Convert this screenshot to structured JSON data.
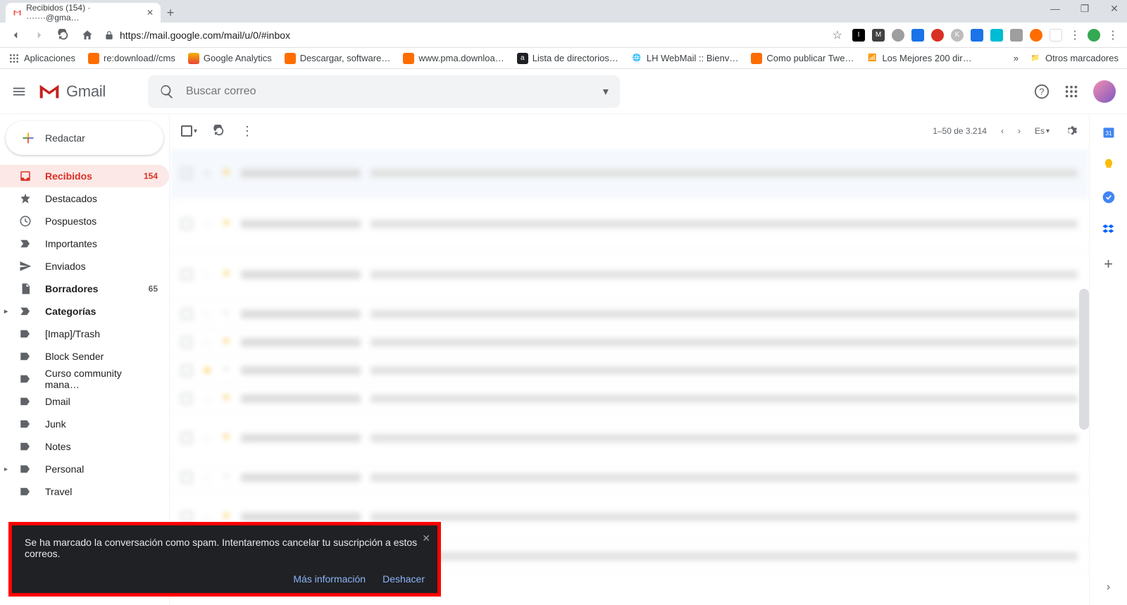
{
  "browser": {
    "tab_title": "Recibidos (154) · ·······@gma…",
    "url": "https://mail.google.com/mail/u/0/#inbox",
    "bookmarks": [
      {
        "label": "Aplicaciones",
        "color": "#5f6368"
      },
      {
        "label": "re:download//cms",
        "color": "#ff6d00"
      },
      {
        "label": "Google Analytics",
        "color": "#f4b400"
      },
      {
        "label": "Descargar, software…",
        "color": "#ff6d00"
      },
      {
        "label": "www.pma.downloa…",
        "color": "#ff6d00"
      },
      {
        "label": "Lista de directorios…",
        "color": "#202124"
      },
      {
        "label": "LH WebMail :: Bienv…",
        "color": "#1a73e8"
      },
      {
        "label": "Como publicar Twe…",
        "color": "#ff6d00"
      },
      {
        "label": "Los Mejores 200 dir…",
        "color": "#1a73e8"
      }
    ],
    "other_bookmarks": "Otros marcadores",
    "overflow": "»"
  },
  "header": {
    "logo_text": "Gmail",
    "search_placeholder": "Buscar correo"
  },
  "compose_label": "Redactar",
  "sidebar": [
    {
      "label": "Recibidos",
      "count": "154",
      "icon": "inbox",
      "active": true,
      "bold": true
    },
    {
      "label": "Destacados",
      "icon": "star"
    },
    {
      "label": "Pospuestos",
      "icon": "clock"
    },
    {
      "label": "Importantes",
      "icon": "important"
    },
    {
      "label": "Enviados",
      "icon": "send"
    },
    {
      "label": "Borradores",
      "count": "65",
      "icon": "draft",
      "bold": true
    },
    {
      "label": "Categorías",
      "icon": "categories",
      "bold": true,
      "expandable": true
    },
    {
      "label": "[Imap]/Trash",
      "icon": "label"
    },
    {
      "label": "Block Sender",
      "icon": "label"
    },
    {
      "label": "Curso community mana…",
      "icon": "label"
    },
    {
      "label": "Dmail",
      "icon": "label"
    },
    {
      "label": "Junk",
      "icon": "label"
    },
    {
      "label": "Notes",
      "icon": "label"
    },
    {
      "label": "Personal",
      "icon": "label",
      "expandable": true
    },
    {
      "label": "Travel",
      "icon": "label"
    }
  ],
  "toolbar": {
    "range": "1–50 de 3.214",
    "lang": "Es"
  },
  "toast": {
    "message": "Se ha marcado la conversación como spam. Intentaremos cancelar tu suscripción a estos correos.",
    "more_info": "Más información",
    "undo": "Deshacer"
  }
}
